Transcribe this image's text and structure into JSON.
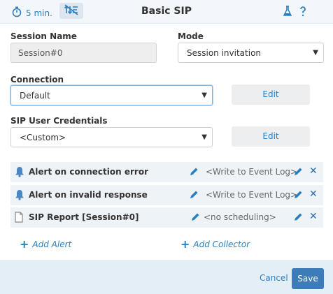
{
  "header": {
    "timer_label": "5 min.",
    "title": "Basic SIP",
    "icons": [
      "stopwatch-icon",
      "arrows-disabled-icon",
      "flask-icon",
      "help-icon"
    ]
  },
  "session_name": {
    "label": "Session Name",
    "value": "Session#0"
  },
  "mode": {
    "label": "Mode",
    "value": "Session invitation"
  },
  "connection": {
    "label": "Connection",
    "value": "Default",
    "edit_label": "Edit"
  },
  "credentials": {
    "label": "SIP User Credentials",
    "value": "<Custom>",
    "edit_label": "Edit"
  },
  "rows": [
    {
      "icon": "bell-icon",
      "label": "Alert on connection error",
      "value": "<Write to Event Log>"
    },
    {
      "icon": "bell-icon",
      "label": "Alert on invalid response",
      "value": "<Write to Event Log>"
    },
    {
      "icon": "document-icon",
      "label": "SIP Report [Session#0]",
      "value": "<no scheduling>"
    }
  ],
  "actions": {
    "add_alert": "Add Alert",
    "add_collector": "Add Collector"
  },
  "footer": {
    "cancel_label": "Cancel",
    "save_label": "Save"
  },
  "colors": {
    "accent": "#2a7fc0",
    "save_bg": "#3c7cb8",
    "row_bg": "#eef3f8",
    "footer_bg": "#e4eef7"
  }
}
